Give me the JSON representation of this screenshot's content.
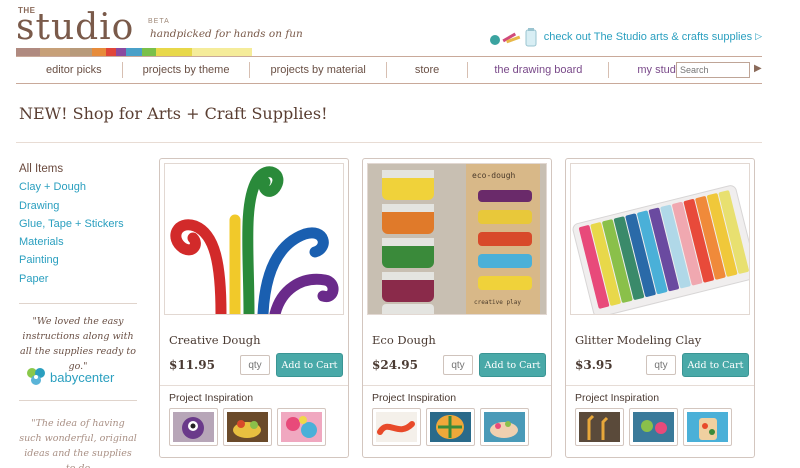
{
  "brand": {
    "the": "THE",
    "name": "studio",
    "beta": "BETA",
    "tagline": "handpicked for hands on fun",
    "strip_colors": [
      "#b08a80",
      "#c7a078",
      "#e78b3a",
      "#e0453a",
      "#8a4aa0",
      "#4aa0c8",
      "#7ac04a",
      "#e8d84a",
      "#f0e87a"
    ]
  },
  "promo": {
    "text": "check out The Studio arts & crafts supplies",
    "arrow_icon": "play-arrow-icon"
  },
  "nav": {
    "items": [
      {
        "label": "editor picks"
      },
      {
        "label": "projects by theme"
      },
      {
        "label": "projects by material"
      },
      {
        "label": "store"
      },
      {
        "label": "the drawing board"
      },
      {
        "label": "my studio"
      }
    ],
    "search_placeholder": "Search"
  },
  "page": {
    "title": "NEW! Shop for Arts + Craft Supplies!"
  },
  "sidebar": {
    "items": [
      {
        "label": "All Items"
      },
      {
        "label": "Clay + Dough"
      },
      {
        "label": "Drawing"
      },
      {
        "label": "Glue, Tape + Stickers"
      },
      {
        "label": "Materials"
      },
      {
        "label": "Painting"
      },
      {
        "label": "Paper"
      }
    ],
    "quote1": "\"We loved the easy instructions along with all the supplies ready to go.\"",
    "quote1_source": "babycenter",
    "quote2": "\"The idea of having such wonderful, original ideas and the supplies to do"
  },
  "products": [
    {
      "name": "Creative Dough",
      "price": "$11.95",
      "qty_placeholder": "qty",
      "button": "Add to Cart",
      "inspiration_label": "Project Inspiration"
    },
    {
      "name": "Eco Dough",
      "price": "$24.95",
      "qty_placeholder": "qty",
      "button": "Add to Cart",
      "inspiration_label": "Project Inspiration",
      "package_text": "eco-dough",
      "package_subtext": "creative play"
    },
    {
      "name": "Glitter Modeling Clay",
      "price": "$3.95",
      "qty_placeholder": "qty",
      "button": "Add to Cart",
      "inspiration_label": "Project Inspiration"
    }
  ],
  "colors": {
    "accent": "#2a9fbf",
    "button": "#49a9a8",
    "brand_brown": "#7a5a4a",
    "nav_purple": "#7a4a8a"
  }
}
